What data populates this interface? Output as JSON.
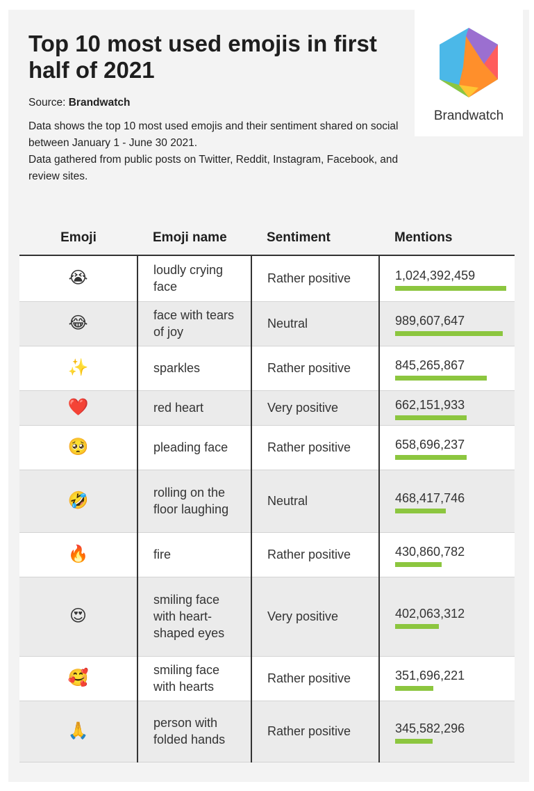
{
  "title": "Top 10 most used emojis in first half of 2021",
  "source_label": "Source: ",
  "source_name": "Brandwatch",
  "description_lines": [
    "Data shows the top 10 most used emojis and their sentiment shared on social between January 1 - June 30 2021.",
    "Data gathered from public posts on Twitter, Reddit, Instagram, Facebook, and review sites."
  ],
  "logo": {
    "text": "Brandwatch",
    "colors": [
      "#4bb8e8",
      "#9b6fd0",
      "#ff5d5d",
      "#ff8f2b",
      "#ffc533",
      "#8cc63f"
    ]
  },
  "colors": {
    "bar": "#8cc63f",
    "background": "#f3f3f3",
    "row_alt": "#ebebeb"
  },
  "table": {
    "headers": {
      "emoji": "Emoji",
      "name": "Emoji name",
      "sentiment": "Sentiment",
      "mentions": "Mentions"
    }
  },
  "chart_data": {
    "type": "bar",
    "orientation": "horizontal",
    "columns": [
      "Emoji",
      "Emoji name",
      "Sentiment",
      "Mentions"
    ],
    "xlim": [
      0,
      1024392459
    ],
    "rows": [
      {
        "emoji": "😭",
        "name": "loudly crying face",
        "sentiment": "Rather positive",
        "mentions": 1024392459,
        "mentions_label": "1,024,392,459"
      },
      {
        "emoji": "😂",
        "name": "face with tears of joy",
        "sentiment": "Neutral",
        "mentions": 989607647,
        "mentions_label": "989,607,647"
      },
      {
        "emoji": "✨",
        "name": "sparkles",
        "sentiment": "Rather positive",
        "mentions": 845265867,
        "mentions_label": "845,265,867"
      },
      {
        "emoji": "❤️",
        "name": "red heart",
        "sentiment": "Very positive",
        "mentions": 662151933,
        "mentions_label": "662,151,933"
      },
      {
        "emoji": "🥺",
        "name": "pleading face",
        "sentiment": "Rather positive",
        "mentions": 658696237,
        "mentions_label": "658,696,237"
      },
      {
        "emoji": "🤣",
        "name": "rolling on the floor laughing",
        "sentiment": "Neutral",
        "mentions": 468417746,
        "mentions_label": "468,417,746"
      },
      {
        "emoji": "🔥",
        "name": "fire",
        "sentiment": "Rather positive",
        "mentions": 430860782,
        "mentions_label": "430,860,782"
      },
      {
        "emoji": "😍",
        "name": "smiling face with heart-shaped eyes",
        "sentiment": "Very positive",
        "mentions": 402063312,
        "mentions_label": "402,063,312"
      },
      {
        "emoji": "🥰",
        "name": "smiling face with hearts",
        "sentiment": "Rather positive",
        "mentions": 351696221,
        "mentions_label": "351,696,221"
      },
      {
        "emoji": "🙏",
        "name": "person with folded hands",
        "sentiment": "Rather positive",
        "mentions": 345582296,
        "mentions_label": "345,582,296"
      }
    ]
  }
}
